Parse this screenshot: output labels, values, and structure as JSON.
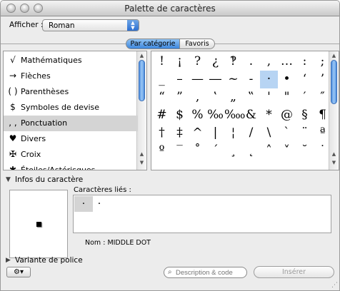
{
  "window": {
    "title": "Palette de caractères"
  },
  "toolbar": {
    "show_label": "Afficher :",
    "show_value": "Roman"
  },
  "tabs": [
    {
      "label": "Par catégorie",
      "selected": true
    },
    {
      "label": "Favoris",
      "selected": false
    }
  ],
  "categories": [
    {
      "icon": "√",
      "icon_name": "square-root-icon",
      "label": "Mathématiques"
    },
    {
      "icon": "→",
      "icon_name": "right-arrow-icon",
      "label": "Flèches"
    },
    {
      "icon": "( )",
      "icon_name": "parentheses-icon",
      "label": "Parenthèses"
    },
    {
      "icon": "$",
      "icon_name": "dollar-icon",
      "label": "Symboles de devise"
    },
    {
      "icon": ", ,",
      "icon_name": "punctuation-icon",
      "label": "Ponctuation",
      "selected": true
    },
    {
      "icon": "♥",
      "icon_name": "heart-icon",
      "label": "Divers"
    },
    {
      "icon": "✠",
      "icon_name": "cross-icon",
      "label": "Croix"
    },
    {
      "icon": "✱",
      "icon_name": "asterisk-icon",
      "label": "Étoiles/Astérisques"
    }
  ],
  "glyph_rows": [
    [
      "!",
      "¡",
      "?",
      "¿",
      "‽",
      ".",
      ",",
      "…",
      ":",
      ";"
    ],
    [
      "_",
      "–",
      "—",
      "―",
      "~",
      "-",
      "·",
      "•",
      "‘",
      "’"
    ],
    [
      "“",
      "”",
      "‚",
      "‛",
      "„",
      "‟",
      "'",
      "\"",
      "′",
      "″"
    ],
    [
      "#",
      "$",
      "%",
      "‰",
      "‱",
      "&",
      "*",
      "@",
      "§",
      "¶"
    ],
    [
      "†",
      "‡",
      "^",
      "|",
      "¦",
      "/",
      "\\",
      "`",
      "¨",
      "ª"
    ],
    [
      "º",
      "‾",
      "˚",
      "´",
      "¸",
      "˛",
      "˄",
      "˅",
      "˘",
      "˙"
    ],
    [
      "",
      "",
      "",
      "",
      "",
      "˳",
      "",
      "",
      "",
      ""
    ]
  ],
  "selected_glyph": {
    "row": 1,
    "col": 6
  },
  "info": {
    "header": "Infos du caractère",
    "related_label": "Caractères liés :",
    "related": [
      "·",
      "·"
    ],
    "name_label": "Nom :",
    "name_value": "MIDDLE DOT"
  },
  "font_variant": {
    "header": "Variante de police"
  },
  "bottom": {
    "gear_label": "⚙▾",
    "search_placeholder": "Description & code",
    "insert_label": "Insérer"
  }
}
